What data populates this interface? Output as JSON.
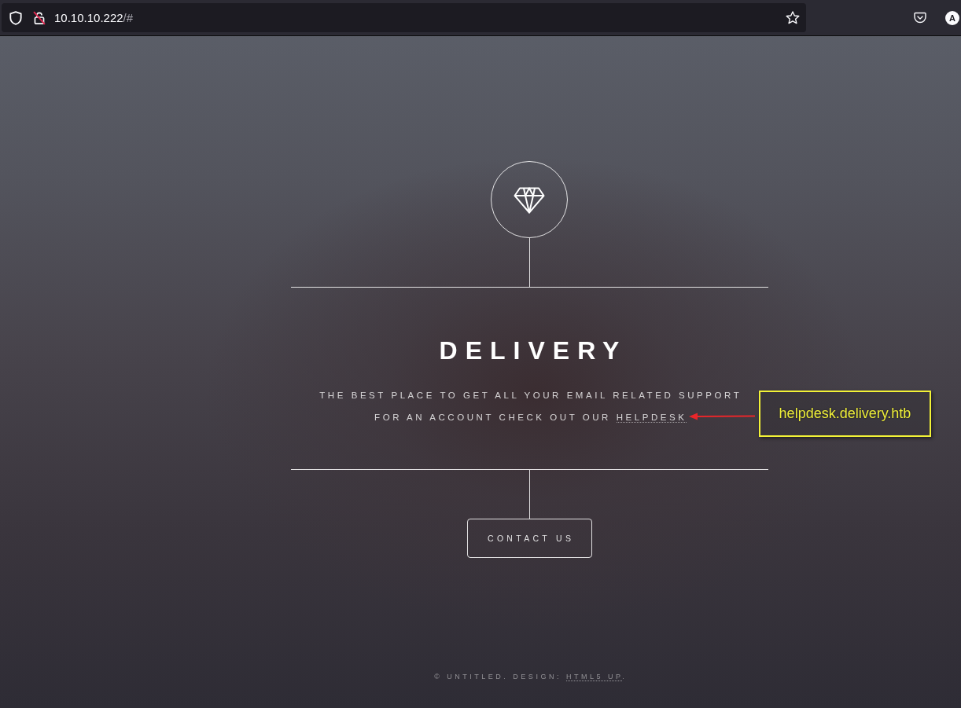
{
  "browser": {
    "url": {
      "host": "10.10.10.222",
      "path": "/#"
    },
    "account_initial": "A"
  },
  "header": {
    "title": "DELIVERY",
    "tagline": {
      "line_1": "THE BEST PLACE TO GET ALL YOUR EMAIL RELATED SUPPORT",
      "line_2": "FOR AN ACCOUNT CHECK OUT OUR",
      "link": "HELPDESK"
    }
  },
  "nav": {
    "button": "CONTACT US"
  },
  "footer": {
    "text": "© UNTITLED. DESIGN:",
    "link": "HTML5 UP",
    "end": "."
  },
  "annotation": {
    "text": "helpdesk.delivery.htb"
  }
}
